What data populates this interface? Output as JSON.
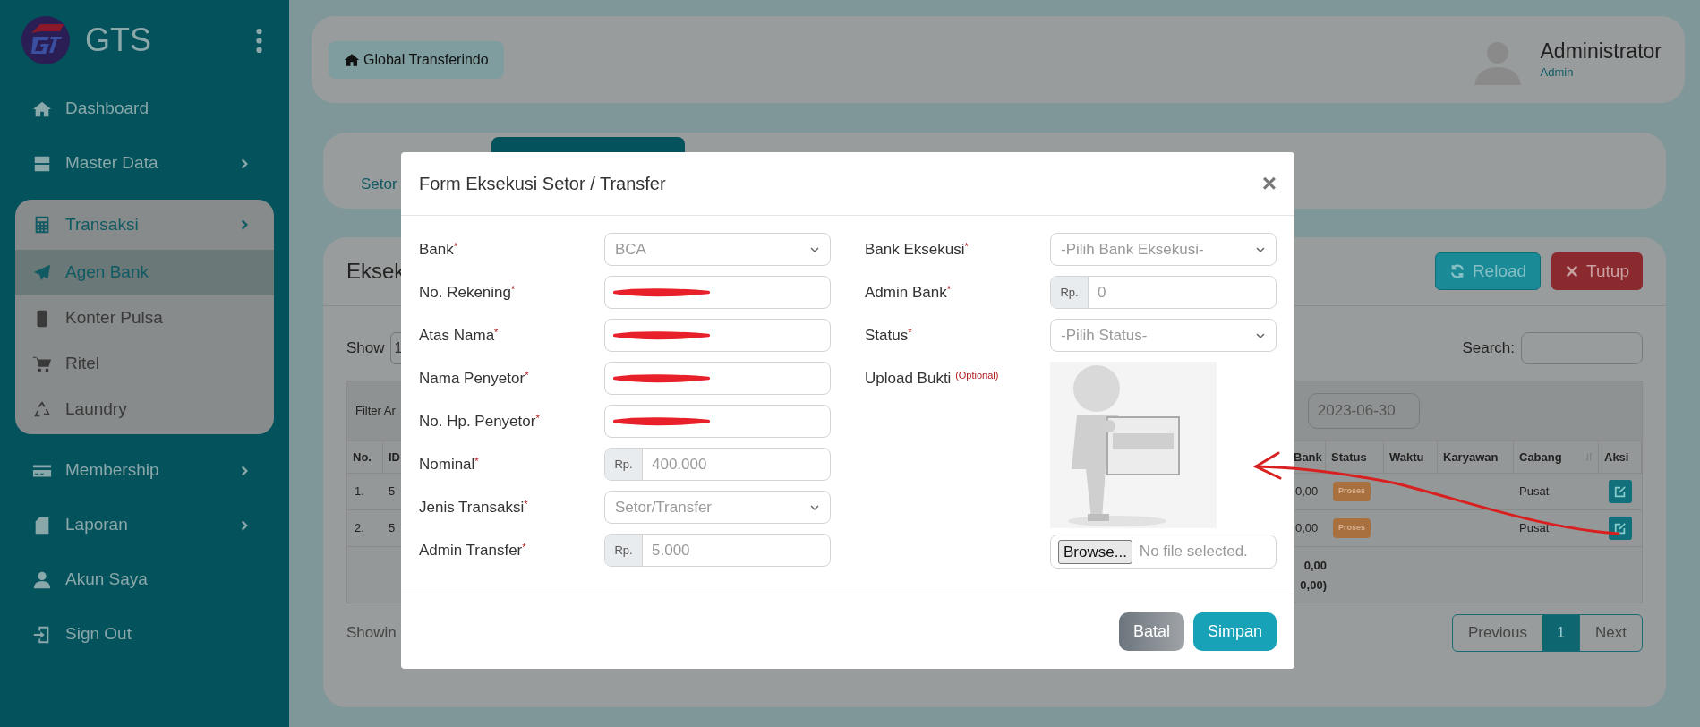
{
  "sidebar": {
    "brand": "GTS",
    "items": [
      {
        "label": "Dashboard",
        "kind": "link"
      },
      {
        "label": "Master Data",
        "kind": "group",
        "expanded": false
      },
      {
        "label": "Transaksi",
        "kind": "group",
        "expanded": true,
        "children": [
          {
            "label": "Agen Bank",
            "selected": true
          },
          {
            "label": "Konter Pulsa",
            "selected": false
          },
          {
            "label": "Ritel",
            "selected": false
          },
          {
            "label": "Laundry",
            "selected": false
          }
        ]
      },
      {
        "label": "Membership",
        "kind": "group",
        "expanded": false
      },
      {
        "label": "Laporan",
        "kind": "group",
        "expanded": false
      },
      {
        "label": "Akun Saya",
        "kind": "link"
      },
      {
        "label": "Sign Out",
        "kind": "link"
      }
    ]
  },
  "header": {
    "breadcrumb": "Global Transferindo",
    "user": {
      "name": "Administrator",
      "role": "Admin"
    }
  },
  "tabs": [
    {
      "label": "Setor",
      "selected": false
    },
    {
      "selected": true
    }
  ],
  "table_card": {
    "title": "Eksek",
    "buttons": [
      {
        "label": "Reload",
        "kind": "reload"
      },
      {
        "label": "Tutup",
        "kind": "close"
      }
    ],
    "show_label": "Show",
    "show_value": "1",
    "search_label": "Search:",
    "filter_label": "Filter Ar",
    "date": "2023-06-30",
    "columns": [
      "No.",
      "ID",
      "Bank",
      "Status",
      "Waktu",
      "Karyawan",
      "Cabang",
      "Aksi"
    ],
    "rows": [
      {
        "no": "1.",
        "id": "5",
        "bank": "0,00",
        "status": "Proses",
        "cabang": "Pusat"
      },
      {
        "no": "2.",
        "id": "5",
        "bank": "0,00",
        "status": "Proses",
        "cabang": "Pusat"
      }
    ],
    "totals": [
      "0,00",
      "0,00)"
    ],
    "showing": "Showin",
    "pagination": {
      "previous": "Previous",
      "pages": [
        {
          "label": "1",
          "selected": true
        }
      ],
      "next": "Next"
    }
  },
  "modal": {
    "title": "Form Eksekusi Setor / Transfer",
    "close": "×",
    "left_fields": [
      {
        "label": "Bank$^{*}$",
        "kind": "select",
        "value": "BCA"
      },
      {
        "label": "No. Rekening$^{*}$",
        "kind": "text",
        "redacted": true
      },
      {
        "label": "Atas Nama$^{*}$",
        "kind": "text",
        "redacted": true
      },
      {
        "label": "Nama Penyetor$^{*}$",
        "kind": "text",
        "redacted": true
      },
      {
        "label": "No. Hp. Penyetor$^{*}$",
        "kind": "text",
        "redacted": true
      },
      {
        "label": "Nominal$^{*}$",
        "kind": "money",
        "prefix": "Rp.",
        "value": "400.000"
      },
      {
        "label": "Jenis Transaksi$^{*}$",
        "kind": "select",
        "value": "Setor/Transfer"
      },
      {
        "label": "Admin Transfer$^{*}$",
        "kind": "money",
        "prefix": "Rp.",
        "value": "5.000"
      }
    ],
    "right_fields": [
      {
        "label": "Bank Eksekusi$^{*}$",
        "kind": "select",
        "value": "-Pilih Bank Eksekusi-"
      },
      {
        "label": "Admin Bank$^{*}$",
        "kind": "money",
        "prefix": "Rp.",
        "value": "0"
      },
      {
        "label": "Status$^{*}$",
        "kind": "select",
        "value": "-Pilih Status-"
      },
      {
        "label": "Upload Bukti $^{(Optional)}$",
        "kind": "file",
        "button": "Browse...",
        "status": "No file selected."
      }
    ],
    "buttons": [
      {
        "label": "Batal",
        "kind": "cancel"
      },
      {
        "label": "Simpan",
        "kind": "save"
      }
    ]
  }
}
